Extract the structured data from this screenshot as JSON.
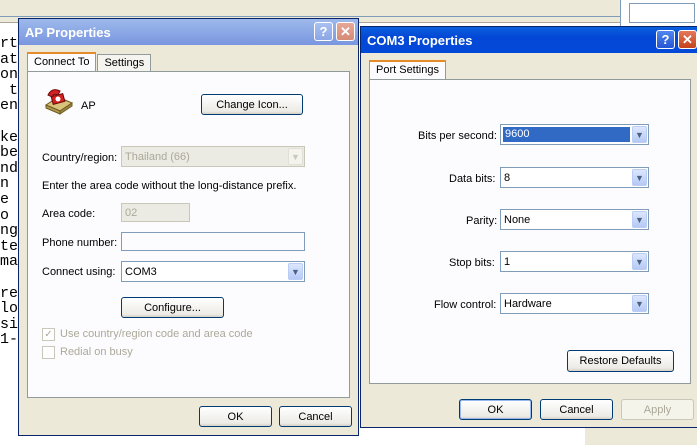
{
  "background_editor": {
    "lines": [
      "rt",
      "at",
      "on",
      " t",
      "enu",
      "",
      "ke",
      "be",
      "nd",
      "n t",
      "e u",
      "o n",
      "ng",
      "te",
      "mai",
      "",
      "re",
      "lo",
      "si",
      "1-"
    ]
  },
  "ap_window": {
    "title": "AP Properties",
    "help_icon": "?",
    "close_icon": "✕",
    "tabs": [
      "Connect To",
      "Settings"
    ],
    "connection_name": "AP",
    "change_icon_label": "Change Icon...",
    "country_label": "Country/region:",
    "country_value": "Thailand (66)",
    "instructions": "Enter the area code without the long-distance prefix.",
    "area_code_label": "Area code:",
    "area_code_value": "02",
    "phone_label": "Phone number:",
    "phone_value": "",
    "connect_using_label": "Connect using:",
    "connect_using_value": "COM3",
    "configure_label": "Configure...",
    "use_country_label": "Use country/region code and area code",
    "redial_label": "Redial on busy",
    "ok_label": "OK",
    "cancel_label": "Cancel"
  },
  "com_window": {
    "title": "COM3 Properties",
    "help_icon": "?",
    "close_icon": "✕",
    "tabs": [
      "Port Settings"
    ],
    "bits_label": "Bits per second:",
    "bits_value": "9600",
    "data_bits_label": "Data bits:",
    "data_bits_value": "8",
    "parity_label": "Parity:",
    "parity_value": "None",
    "stop_bits_label": "Stop bits:",
    "stop_bits_value": "1",
    "flow_label": "Flow control:",
    "flow_value": "Hardware",
    "restore_label": "Restore Defaults",
    "ok_label": "OK",
    "cancel_label": "Cancel",
    "apply_label": "Apply"
  },
  "colors": {
    "title_active": "#0347d6",
    "title_inactive": "#7a96df",
    "dialog_bg": "#ece9d8",
    "selection": "#316ac5"
  }
}
